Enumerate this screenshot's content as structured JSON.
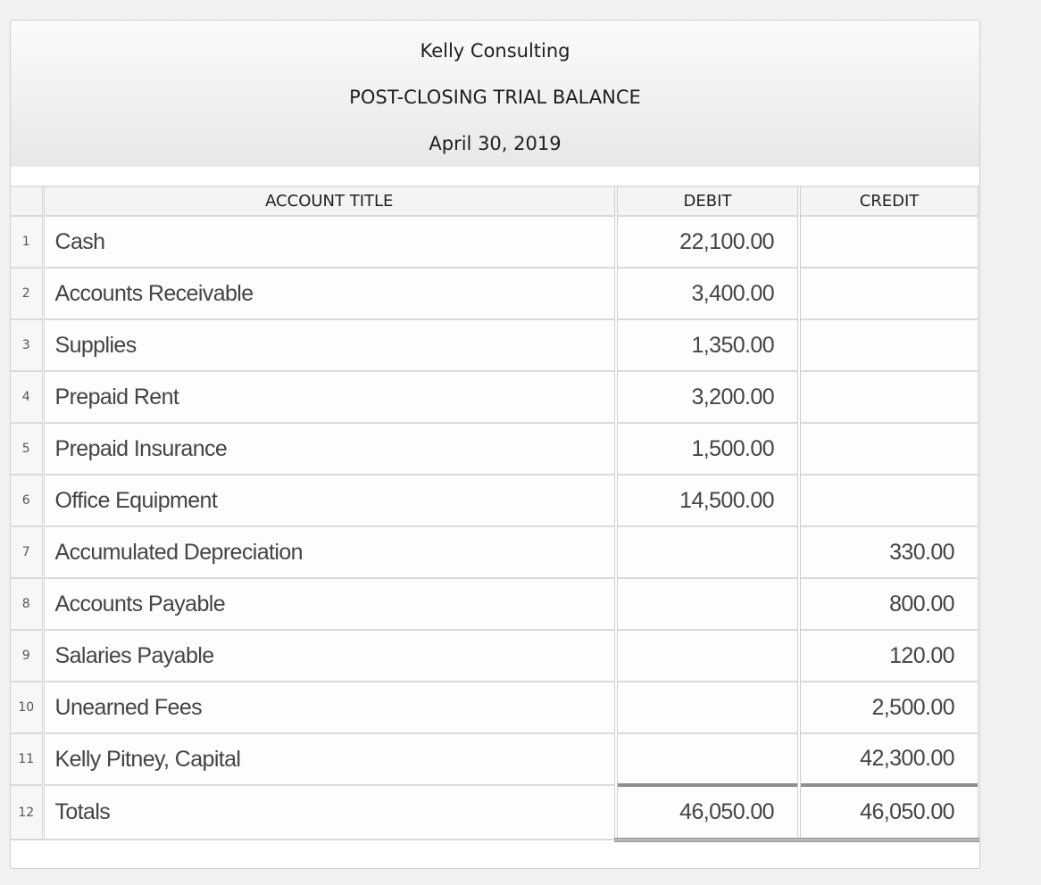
{
  "header": {
    "company": "Kelly Consulting",
    "title": "POST-CLOSING TRIAL BALANCE",
    "date": "April 30, 2019"
  },
  "columns": {
    "account_title": "ACCOUNT TITLE",
    "debit": "DEBIT",
    "credit": "CREDIT"
  },
  "rows": [
    {
      "num": "1",
      "account": "Cash",
      "debit": "22,100.00",
      "credit": ""
    },
    {
      "num": "2",
      "account": "Accounts Receivable",
      "debit": "3,400.00",
      "credit": ""
    },
    {
      "num": "3",
      "account": "Supplies",
      "debit": "1,350.00",
      "credit": ""
    },
    {
      "num": "4",
      "account": "Prepaid Rent",
      "debit": "3,200.00",
      "credit": ""
    },
    {
      "num": "5",
      "account": "Prepaid Insurance",
      "debit": "1,500.00",
      "credit": ""
    },
    {
      "num": "6",
      "account": "Office Equipment",
      "debit": "14,500.00",
      "credit": ""
    },
    {
      "num": "7",
      "account": "Accumulated Depreciation",
      "debit": "",
      "credit": "330.00"
    },
    {
      "num": "8",
      "account": "Accounts Payable",
      "debit": "",
      "credit": "800.00"
    },
    {
      "num": "9",
      "account": "Salaries Payable",
      "debit": "",
      "credit": "120.00"
    },
    {
      "num": "10",
      "account": "Unearned Fees",
      "debit": "",
      "credit": "2,500.00"
    },
    {
      "num": "11",
      "account": "Kelly Pitney, Capital",
      "debit": "",
      "credit": "42,300.00"
    }
  ],
  "totals": {
    "num": "12",
    "account": "Totals",
    "debit": "46,050.00",
    "credit": "46,050.00"
  }
}
